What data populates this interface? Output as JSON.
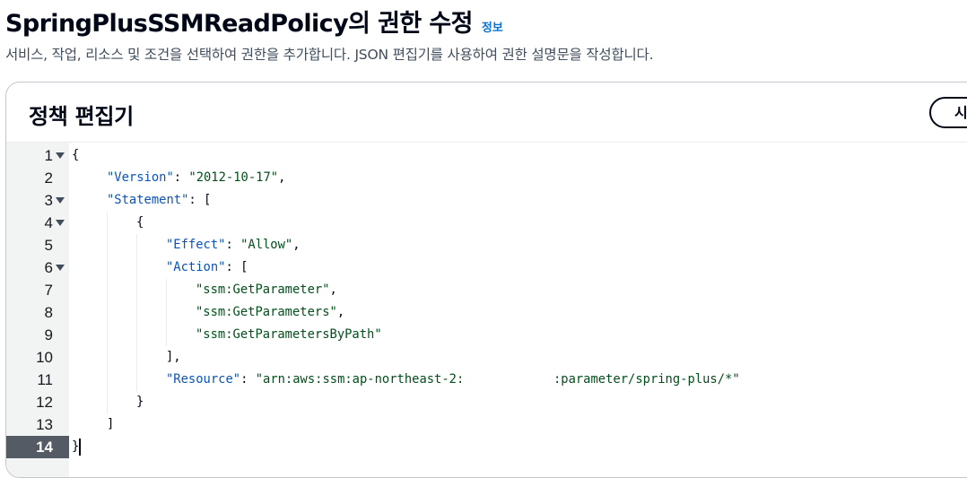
{
  "header": {
    "title": "SpringPlusSSMReadPolicy의 권한 수정",
    "info_label": "정보",
    "description": "서비스, 작업, 리소스 및 조건을 선택하여 권한을 추가합니다. JSON 편집기를 사용하여 권한 설명문을 작성합니다."
  },
  "editor": {
    "title": "정책 편집기",
    "visual_button_label": "시",
    "active_line": 14,
    "lines": [
      {
        "num": "1",
        "fold": true,
        "indent": 0,
        "tokens": [
          {
            "t": "p",
            "v": "{"
          }
        ]
      },
      {
        "num": "2",
        "fold": false,
        "indent": 1,
        "tokens": [
          {
            "t": "k",
            "v": "\"Version\""
          },
          {
            "t": "p",
            "v": ": "
          },
          {
            "t": "s",
            "v": "\"2012-10-17\""
          },
          {
            "t": "p",
            "v": ","
          }
        ]
      },
      {
        "num": "3",
        "fold": true,
        "indent": 1,
        "tokens": [
          {
            "t": "k",
            "v": "\"Statement\""
          },
          {
            "t": "p",
            "v": ": ["
          }
        ]
      },
      {
        "num": "4",
        "fold": true,
        "indent": 2,
        "tokens": [
          {
            "t": "p",
            "v": "{"
          }
        ]
      },
      {
        "num": "5",
        "fold": false,
        "indent": 3,
        "tokens": [
          {
            "t": "k",
            "v": "\"Effect\""
          },
          {
            "t": "p",
            "v": ": "
          },
          {
            "t": "s",
            "v": "\"Allow\""
          },
          {
            "t": "p",
            "v": ","
          }
        ]
      },
      {
        "num": "6",
        "fold": true,
        "indent": 3,
        "tokens": [
          {
            "t": "k",
            "v": "\"Action\""
          },
          {
            "t": "p",
            "v": ": ["
          }
        ]
      },
      {
        "num": "7",
        "fold": false,
        "indent": 4,
        "tokens": [
          {
            "t": "s",
            "v": "\"ssm:GetParameter\""
          },
          {
            "t": "p",
            "v": ","
          }
        ]
      },
      {
        "num": "8",
        "fold": false,
        "indent": 4,
        "tokens": [
          {
            "t": "s",
            "v": "\"ssm:GetParameters\""
          },
          {
            "t": "p",
            "v": ","
          }
        ]
      },
      {
        "num": "9",
        "fold": false,
        "indent": 4,
        "tokens": [
          {
            "t": "s",
            "v": "\"ssm:GetParametersByPath\""
          }
        ]
      },
      {
        "num": "10",
        "fold": false,
        "indent": 3,
        "tokens": [
          {
            "t": "p",
            "v": "],"
          }
        ]
      },
      {
        "num": "11",
        "fold": false,
        "indent": 3,
        "tokens": [
          {
            "t": "k",
            "v": "\"Resource\""
          },
          {
            "t": "p",
            "v": ": "
          },
          {
            "t": "s",
            "v": "\"arn:aws:ssm:ap-northeast-2:            :parameter/spring-plus/*\""
          }
        ]
      },
      {
        "num": "12",
        "fold": false,
        "indent": 2,
        "tokens": [
          {
            "t": "p",
            "v": "}"
          }
        ]
      },
      {
        "num": "13",
        "fold": false,
        "indent": 1,
        "tokens": [
          {
            "t": "p",
            "v": "]"
          }
        ]
      },
      {
        "num": "14",
        "fold": false,
        "indent": 0,
        "tokens": [
          {
            "t": "p",
            "v": "}"
          }
        ]
      }
    ]
  },
  "colors": {
    "json_key": "#0b53b8",
    "json_string": "#024f1c",
    "link": "#0972d3",
    "active_gutter": "#545b64"
  }
}
